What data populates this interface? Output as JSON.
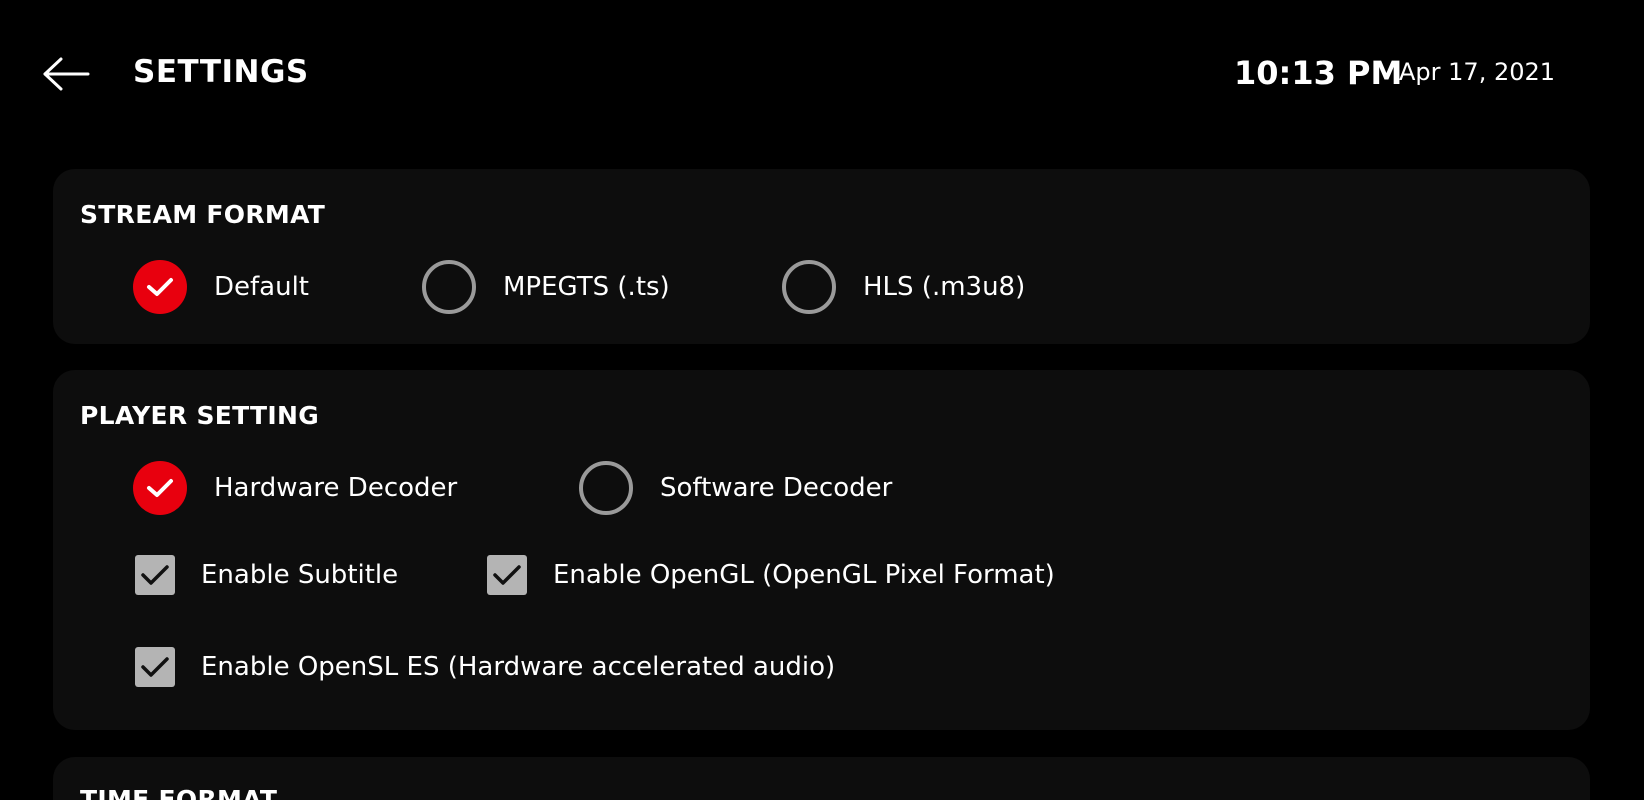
{
  "header": {
    "back_icon": "arrow-left-icon",
    "title": "SETTINGS",
    "time": "10:13 PM",
    "date": "Apr 17, 2021"
  },
  "stream_format": {
    "title": "STREAM FORMAT",
    "options": [
      {
        "label": "Default",
        "selected": true
      },
      {
        "label": "MPEGTS (.ts)",
        "selected": false
      },
      {
        "label": "HLS (.m3u8)",
        "selected": false
      }
    ]
  },
  "player_setting": {
    "title": "PLAYER SETTING",
    "decoders": [
      {
        "label": "Hardware Decoder",
        "selected": true
      },
      {
        "label": "Software Decoder",
        "selected": false
      }
    ],
    "checkboxes": [
      {
        "label": "Enable Subtitle",
        "checked": true
      },
      {
        "label": "Enable OpenGL (OpenGL Pixel Format)",
        "checked": true
      },
      {
        "label": "Enable OpenSL ES (Hardware accelerated audio)",
        "checked": true
      }
    ]
  },
  "time_format": {
    "title": "TIME FORMAT"
  },
  "colors": {
    "background": "#000000",
    "card": "#0d0d0d",
    "accent": "#e8000e",
    "radio_unchecked": "#9a9a9a",
    "checkbox": "#b4b4b4"
  }
}
